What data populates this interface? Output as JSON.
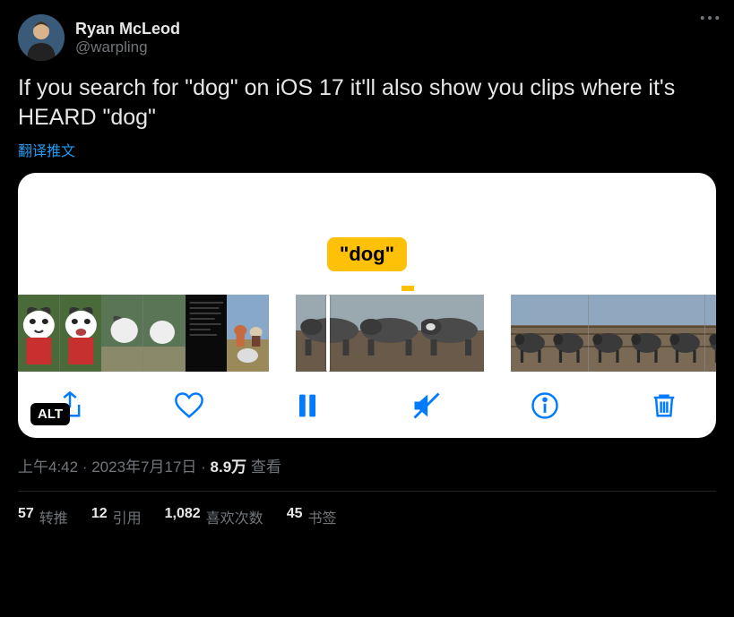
{
  "author": {
    "display_name": "Ryan McLeod",
    "handle": "@warpling"
  },
  "tweet_text": "If you search for \"dog\" on iOS 17 it'll also show you clips where it's HEARD \"dog\"",
  "translate_label": "翻译推文",
  "media": {
    "search_label": "\"dog\"",
    "alt_badge": "ALT"
  },
  "meta": {
    "time": "上午4:42",
    "date": "2023年7月17日",
    "views_count": "8.9万",
    "views_label": "查看"
  },
  "stats": {
    "retweets_n": "57",
    "retweets_l": "转推",
    "quotes_n": "12",
    "quotes_l": "引用",
    "likes_n": "1,082",
    "likes_l": "喜欢次数",
    "bookmarks_n": "45",
    "bookmarks_l": "书签"
  }
}
